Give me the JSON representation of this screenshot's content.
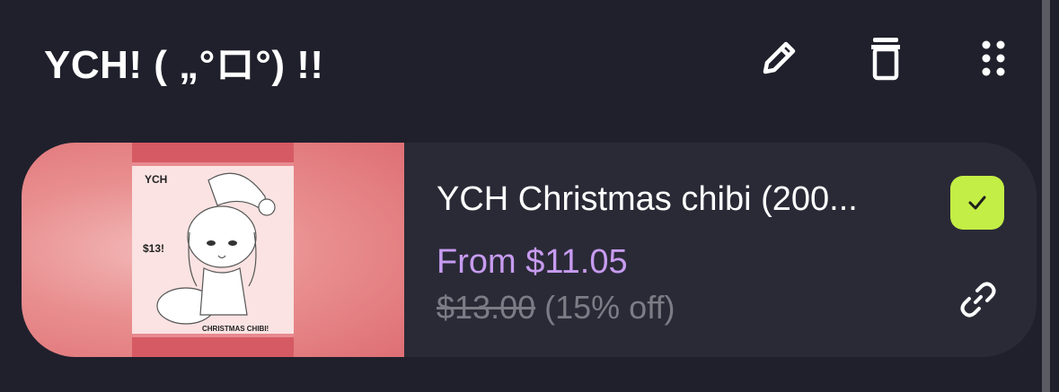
{
  "header": {
    "title": "YCH! ( „°ロ°) !!",
    "edit_icon": "pencil-icon",
    "delete_icon": "trash-icon",
    "drag_icon": "drag-handle-icon"
  },
  "item": {
    "title": "YCH Christmas chibi (200...",
    "price": "From $11.05",
    "original_price": "$13.00",
    "discount": "(15% off)",
    "selected": true,
    "link_icon": "link-icon",
    "thumbnail": {
      "text_top": "YCH",
      "text_price": "$13!",
      "text_bottom": "CHRISTMAS CHIBI!"
    }
  },
  "colors": {
    "background": "#20202c",
    "card": "#2a2a37",
    "price": "#c79bf0",
    "muted": "#7c7c86",
    "check": "#c3ee45",
    "thumb_bg": "#e98f90"
  }
}
